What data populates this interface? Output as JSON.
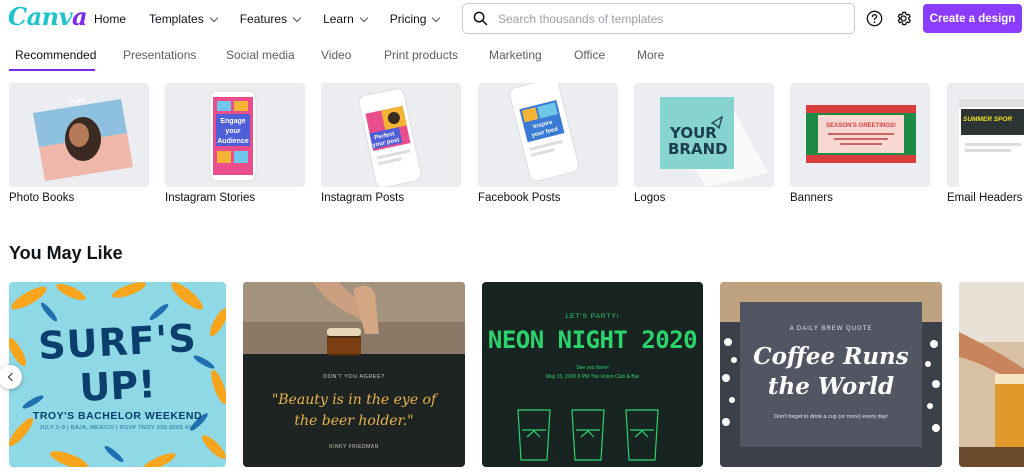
{
  "header": {
    "logo_text_a": "Canv",
    "logo_text_b": "a",
    "nav": [
      "Home",
      "Templates",
      "Features",
      "Learn",
      "Pricing"
    ],
    "search_placeholder": "Search thousands of templates",
    "help_icon": "help-circle-icon",
    "settings_icon": "gear-icon",
    "create_label": "Create a design",
    "brand_color": "#8b3dff"
  },
  "tabs": {
    "items": [
      "Recommended",
      "Presentations",
      "Social media",
      "Video",
      "Print products",
      "Marketing",
      "Office",
      "More"
    ],
    "active": "Recommended"
  },
  "categories": [
    {
      "label": "Photo Books"
    },
    {
      "label": "Instagram Stories",
      "screen_lines": [
        "Engage",
        "your",
        "Audience"
      ]
    },
    {
      "label": "Instagram Posts",
      "screen_lines": [
        "Perfect",
        "your post"
      ]
    },
    {
      "label": "Facebook Posts",
      "screen_lines": [
        "Inspire",
        "your feed"
      ]
    },
    {
      "label": "Logos",
      "logo_lines": [
        "YOUR",
        "BRAND"
      ]
    },
    {
      "label": "Banners",
      "banner_text": "SEASON'S GREETINGS!"
    },
    {
      "label": "Email Headers",
      "header_text": "SUMMER SPOR"
    }
  ],
  "you_may_like": {
    "title": "You May Like",
    "templates": [
      {
        "line1": "SURF'S",
        "line2": "UP!",
        "sub": "TROY'S BACHELOR WEEKEND",
        "details": "JULY 5-9 | BAJA, MEXICO | RSVP TROY 555.9088.421"
      },
      {
        "small": "DON'T YOU AGREE?",
        "quote_line1": "\"Beauty is in the eye of",
        "quote_line2": "the beer holder.\"",
        "author": "KINKY FRIEDMAN"
      },
      {
        "party": "LET'S PARTY!",
        "title": "NEON NIGHT 2020",
        "see": "See you there!",
        "when": "May 15, 2020 8 PM The Union Club & Bar"
      },
      {
        "label": "A DAILY BREW QUOTE",
        "line1": "Coffee Runs",
        "line2": "the World",
        "tagline": "Don't forget to drink a cup (or more) every day!"
      }
    ]
  }
}
